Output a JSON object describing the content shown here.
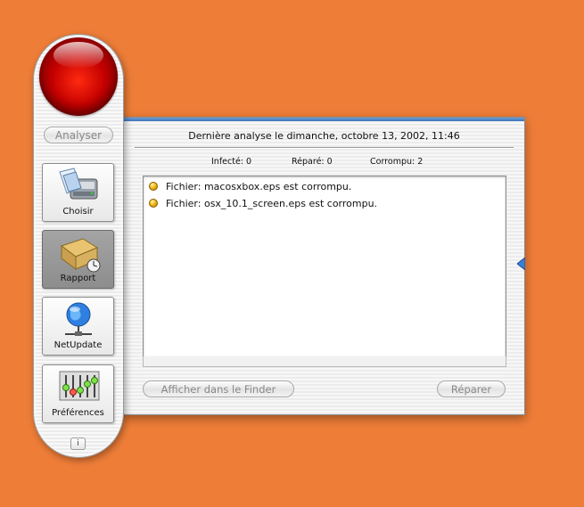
{
  "report_window": {
    "last_scan": "Dernière analyse le dimanche, octobre 13, 2002, 11:46",
    "stats": {
      "infected": "Infecté: 0",
      "repaired": "Réparé: 0",
      "corrupted": "Corrompu: 2"
    },
    "results": [
      {
        "text": "Fichier: macosxbox.eps est corrompu.",
        "status_color": "#f0b400"
      },
      {
        "text": "Fichier: osx_10.1_screen.eps est corrompu.",
        "status_color": "#f0b400"
      }
    ],
    "buttons": {
      "show_in_finder": "Afficher dans le Finder",
      "repair": "Réparer"
    }
  },
  "toolbar": {
    "analyze": "Analyser",
    "tools": [
      {
        "label": "Choisir",
        "icon": "choose-icon",
        "active": false
      },
      {
        "label": "Rapport",
        "icon": "report-icon",
        "active": true
      },
      {
        "label": "NetUpdate",
        "icon": "netupdate-icon",
        "active": false
      },
      {
        "label": "Préférences",
        "icon": "preferences-icon",
        "active": false
      }
    ],
    "info": "i"
  },
  "colors": {
    "desktop": "#ee7d38",
    "orb": "#c40000",
    "status_dot": "#f0b400"
  }
}
